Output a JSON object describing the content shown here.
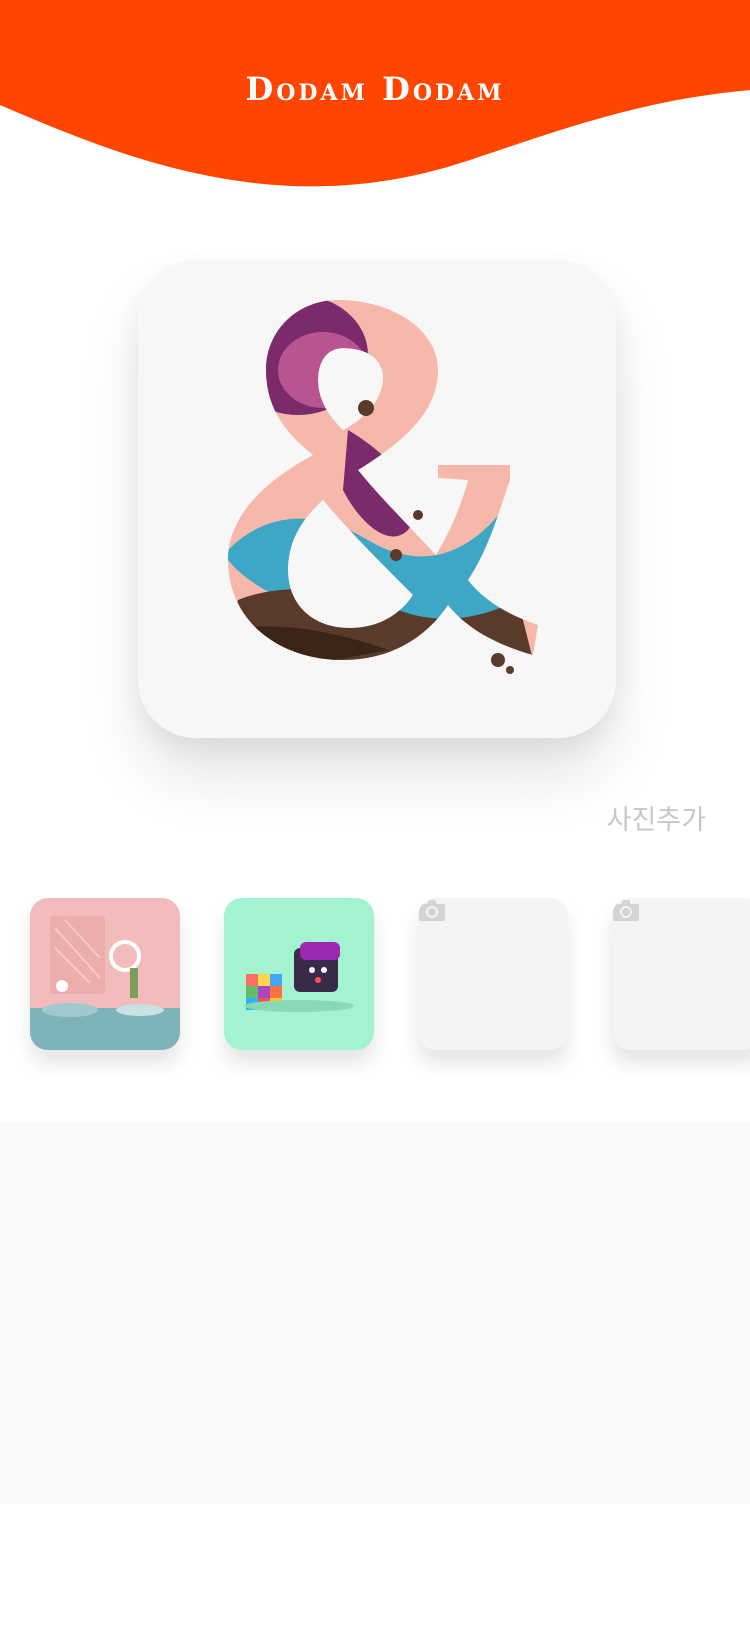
{
  "header": {
    "title": "Dodam Dodam",
    "color": "#FF4500"
  },
  "hero": {
    "image": "ampersand-papercut-art"
  },
  "actions": {
    "add_photo_label": "사진추가"
  },
  "thumbnails": [
    {
      "image": "pink-room-3d-illustration",
      "state": "filled"
    },
    {
      "image": "rubik-cube-robot-illustration",
      "state": "filled"
    },
    {
      "image": "camera-icon",
      "state": "empty"
    },
    {
      "image": "camera-icon",
      "state": "empty"
    }
  ]
}
